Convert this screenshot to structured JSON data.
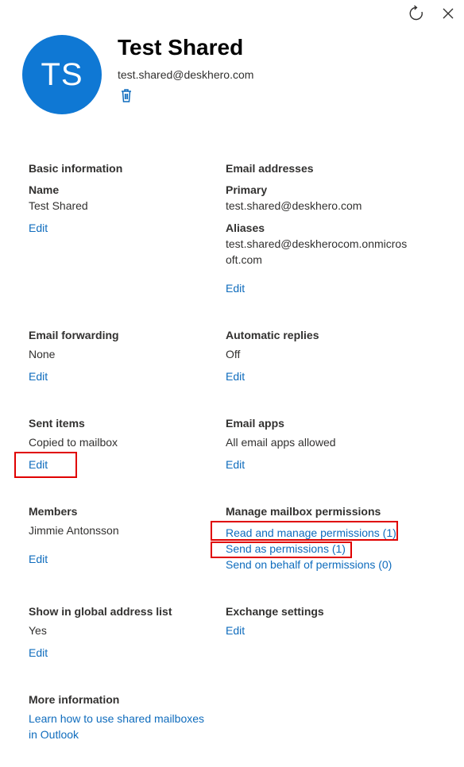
{
  "header": {
    "initials": "TS",
    "name": "Test Shared",
    "email": "test.shared@deskhero.com"
  },
  "icons": {
    "refresh": "refresh-icon",
    "close": "close-icon",
    "delete": "trash-icon"
  },
  "sections": {
    "basic": {
      "title": "Basic information",
      "name_label": "Name",
      "name_value": "Test Shared",
      "edit": "Edit"
    },
    "addresses": {
      "title": "Email addresses",
      "primary_label": "Primary",
      "primary_value": "test.shared@deskhero.com",
      "aliases_label": "Aliases",
      "aliases_line1": "test.shared@deskherocom.onmicros",
      "aliases_line2": "oft.com",
      "edit": "Edit"
    },
    "forwarding": {
      "title": "Email forwarding",
      "value": "None",
      "edit": "Edit"
    },
    "auto_replies": {
      "title": "Automatic replies",
      "value": "Off",
      "edit": "Edit"
    },
    "sent_items": {
      "title": "Sent items",
      "value": "Copied to mailbox",
      "edit": "Edit"
    },
    "email_apps": {
      "title": "Email apps",
      "value": "All email apps allowed",
      "edit": "Edit"
    },
    "members": {
      "title": "Members",
      "value": "Jimmie Antonsson",
      "edit": "Edit"
    },
    "permissions": {
      "title": "Manage mailbox permissions",
      "read_manage": "Read and manage permissions (1)",
      "send_as": "Send as permissions (1)",
      "send_on_behalf": "Send on behalf of permissions (0)"
    },
    "gal": {
      "title": "Show in global address list",
      "value": "Yes",
      "edit": "Edit"
    },
    "exchange": {
      "title": "Exchange settings",
      "edit": "Edit"
    },
    "more": {
      "title": "More information",
      "link_line1": "Learn how to use shared mailboxes",
      "link_line2": "in Outlook"
    }
  },
  "highlight_color": "#e00000",
  "accent_color": "#0f78d4",
  "link_color": "#0f6cbd"
}
